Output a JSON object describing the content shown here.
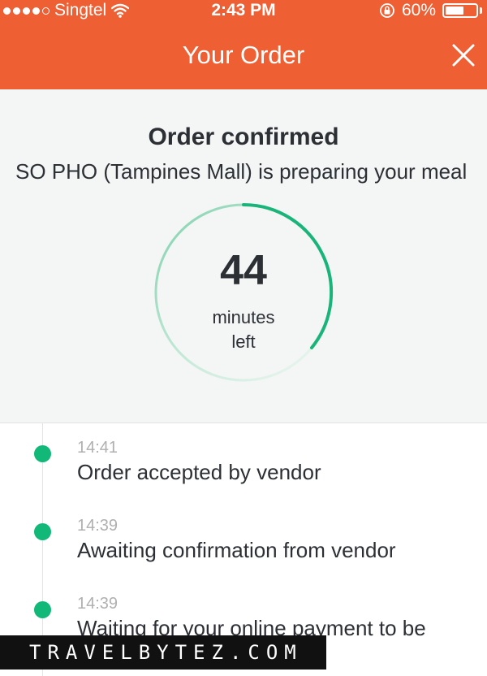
{
  "status_bar": {
    "carrier": "Singtel",
    "time": "2:43 PM",
    "battery": "60%",
    "battery_level": 0.6,
    "signal_bars": 4,
    "signal_max": 5
  },
  "header": {
    "title": "Your Order",
    "close_icon": "close-icon",
    "background_color": "#ee5f33"
  },
  "status": {
    "title": "Order confirmed",
    "subtitle": "SO PHO (Tampines Mall) is preparing your meal",
    "minutes_left": "44",
    "minutes_label_1": "minutes",
    "minutes_label_2": "left",
    "accent_color": "#12b878"
  },
  "timeline": [
    {
      "time": "14:41",
      "text": "Order accepted by vendor"
    },
    {
      "time": "14:39",
      "text": "Awaiting confirmation from vendor"
    },
    {
      "time": "14:39",
      "text": "Waiting for your online payment to be"
    }
  ],
  "watermark": "TRAVELBYTEZ.COM"
}
